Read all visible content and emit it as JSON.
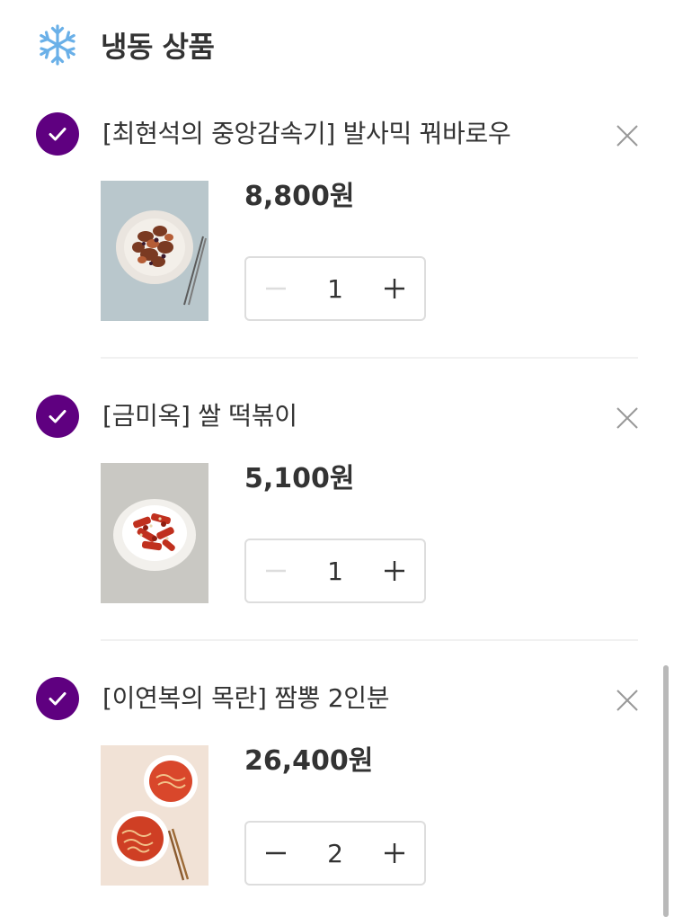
{
  "section": {
    "title": "냉동 상품",
    "icon": "snowflake-icon"
  },
  "items": [
    {
      "name": "[최현석의 중앙감속기] 발사믹 꿔바로우",
      "price": "8,800원",
      "quantity": "1",
      "checked": true,
      "minus_enabled": false
    },
    {
      "name": "[금미옥] 쌀 떡볶이",
      "price": "5,100원",
      "quantity": "1",
      "checked": true,
      "minus_enabled": false
    },
    {
      "name": "[이연복의 목란] 짬뽕 2인분",
      "price": "26,400원",
      "quantity": "2",
      "checked": true,
      "minus_enabled": true
    }
  ],
  "colors": {
    "accent": "#5f0080",
    "snowflake": "#6ab0e8",
    "disabled": "#dddddd",
    "text": "#333333"
  }
}
